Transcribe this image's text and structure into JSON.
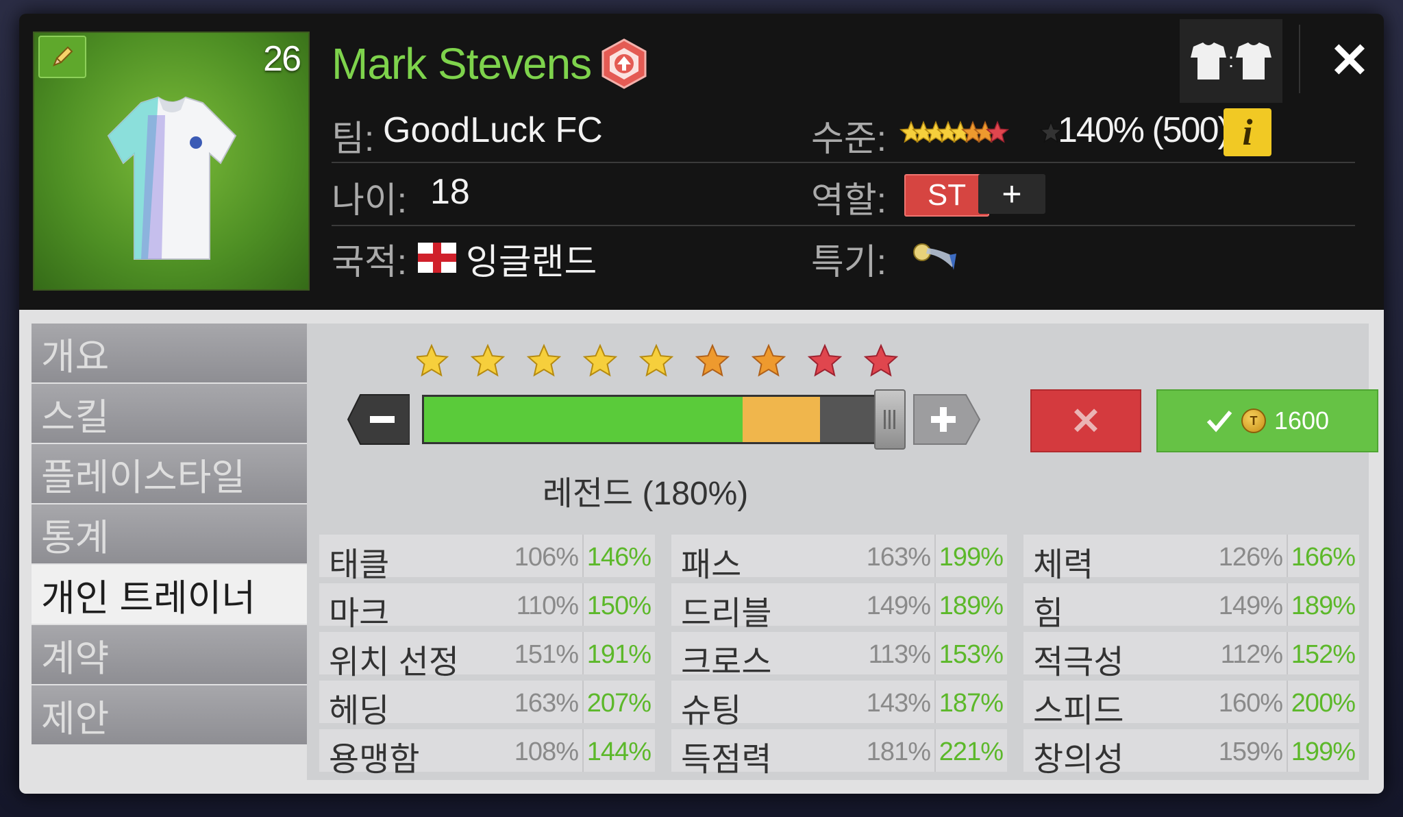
{
  "player": {
    "number": "26",
    "name": "Mark Stevens",
    "team_label": "팀:",
    "team": "GoodLuck FC",
    "age_label": "나이:",
    "age": "18",
    "nationality_label": "국적:",
    "nationality": "잉글랜드",
    "level_label": "수준:",
    "level_text": "140% (500)",
    "role_label": "역할:",
    "role": "ST",
    "role_add": "+",
    "specialty_label": "특기:"
  },
  "header_icons": {
    "edit": "pencil-icon",
    "rank": "rank-up-badge-icon",
    "kit": "kit-compare-icon",
    "kit_separator": ":",
    "close": "✕",
    "info": "i"
  },
  "sidebar": {
    "items": [
      {
        "label": "개요"
      },
      {
        "label": "스킬"
      },
      {
        "label": "플레이스타일"
      },
      {
        "label": "통계"
      },
      {
        "label": "개인 트레이너",
        "active": true
      },
      {
        "label": "계약"
      },
      {
        "label": "제안"
      }
    ]
  },
  "training": {
    "stars": [
      "gold",
      "gold",
      "gold",
      "gold",
      "gold",
      "orange",
      "orange",
      "red",
      "red"
    ],
    "current_progress": 0.7,
    "target_progress": 0.87,
    "level_label": "레전드 (180%)",
    "cancel_label": "✕",
    "cost": "1600",
    "coin_letter": "T"
  },
  "stats": {
    "columns": [
      [
        {
          "name": "태클",
          "current": "106%",
          "new": "146%"
        },
        {
          "name": "마크",
          "current": "110%",
          "new": "150%"
        },
        {
          "name": "위치 선정",
          "current": "151%",
          "new": "191%"
        },
        {
          "name": "헤딩",
          "current": "163%",
          "new": "207%"
        },
        {
          "name": "용맹함",
          "current": "108%",
          "new": "144%"
        }
      ],
      [
        {
          "name": "패스",
          "current": "163%",
          "new": "199%"
        },
        {
          "name": "드리블",
          "current": "149%",
          "new": "189%"
        },
        {
          "name": "크로스",
          "current": "113%",
          "new": "153%"
        },
        {
          "name": "슈팅",
          "current": "143%",
          "new": "187%"
        },
        {
          "name": "득점력",
          "current": "181%",
          "new": "221%"
        }
      ],
      [
        {
          "name": "체력",
          "current": "126%",
          "new": "166%"
        },
        {
          "name": "힘",
          "current": "149%",
          "new": "189%"
        },
        {
          "name": "적극성",
          "current": "112%",
          "new": "152%"
        },
        {
          "name": "스피드",
          "current": "160%",
          "new": "200%"
        },
        {
          "name": "창의성",
          "current": "159%",
          "new": "199%"
        }
      ]
    ]
  },
  "colors": {
    "name_green": "#7ed34c",
    "stat_new_green": "#5cb82a",
    "role_red": "#d64541",
    "confirm_green": "#66c245",
    "cancel_red": "#d43a3e",
    "bar_green": "#5acb3a",
    "bar_orange": "#f0b64c"
  }
}
